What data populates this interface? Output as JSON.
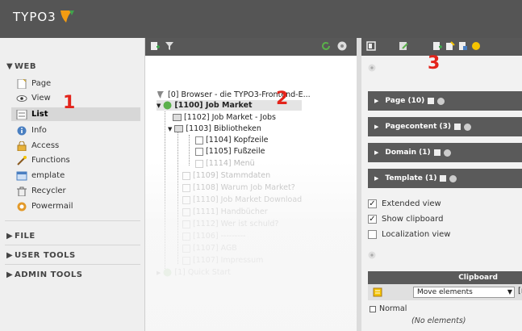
{
  "app": {
    "logo_text": "TYPO3"
  },
  "sidebar": {
    "sections": [
      {
        "label": "WEB",
        "arrow": "▼"
      },
      {
        "label": "FILE",
        "arrow": "▶"
      },
      {
        "label": "USER TOOLS",
        "arrow": "▶"
      },
      {
        "label": "ADMIN TOOLS",
        "arrow": "▶"
      }
    ],
    "modules": [
      {
        "label": "Page",
        "icon": "page-icon"
      },
      {
        "label": "View",
        "icon": "eye-icon"
      },
      {
        "label": "List",
        "icon": "list-icon",
        "active": true
      },
      {
        "label": "Info",
        "icon": "info-icon"
      },
      {
        "label": "Access",
        "icon": "lock-icon"
      },
      {
        "label": "Functions",
        "icon": "wand-icon"
      },
      {
        "label": "emplate",
        "icon": "template-icon"
      },
      {
        "label": "Recycler",
        "icon": "recycler-icon"
      },
      {
        "label": "Powermail",
        "icon": "powermail-icon"
      }
    ]
  },
  "tree": {
    "nodes": [
      {
        "label": "[0] Browser - die TYPO3-Frontend-E...",
        "faded": false
      },
      {
        "label": "[1100] Job Market",
        "faded": false
      },
      {
        "label": "[1102] Job Market - Jobs",
        "faded": false
      },
      {
        "label": "[1103] Bibliotheken",
        "faded": false
      },
      {
        "label": "[1104] Kopfzeile",
        "faded": false
      },
      {
        "label": "[1105] Fußzeile",
        "faded": false
      },
      {
        "label": "[1114] Menü",
        "faded": true
      },
      {
        "label": "[1109] Stammdaten",
        "faded": true
      },
      {
        "label": "[1108] Warum Job Market?",
        "faded": true
      },
      {
        "label": "[1110] Job Market Download",
        "faded": true
      },
      {
        "label": "[1111] Handbücher",
        "faded": true
      },
      {
        "label": "[1112] Wer ist schuld?",
        "faded": true
      },
      {
        "label": "[1106] ---------",
        "faded": true
      },
      {
        "label": "[1107] AGB",
        "faded": true
      },
      {
        "label": "[1107] Impressum",
        "faded": true
      },
      {
        "label": "[1] Quick Start",
        "faded": true
      }
    ]
  },
  "panels": [
    {
      "label": "Page (10)"
    },
    {
      "label": "Pagecontent (3)"
    },
    {
      "label": "Domain (1)"
    },
    {
      "label": "Template (1)"
    }
  ],
  "options": [
    {
      "label": "Extended view",
      "checked": true
    },
    {
      "label": "Show clipboard",
      "checked": true
    },
    {
      "label": "Localization view",
      "checked": false
    }
  ],
  "clipboard": {
    "title": "Clipboard",
    "select_value": "Move elements",
    "bracket": "[r",
    "normal_label": "Normal",
    "empty_label": "(No elements)"
  },
  "markers": [
    "1",
    "2",
    "3"
  ],
  "colors": {
    "topbar": "#555555",
    "logo_accent": "#f39c12",
    "marker": "#e3241b"
  }
}
